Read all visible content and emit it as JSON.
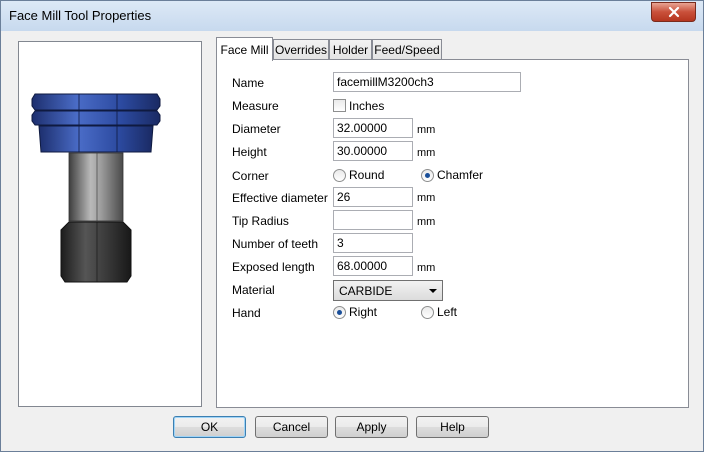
{
  "window": {
    "title": "Face Mill Tool Properties",
    "close_icon": "close-icon"
  },
  "tabs": [
    "Face Mill",
    "Overrides",
    "Holder",
    "Feed/Speed"
  ],
  "active_tab": "Face Mill",
  "form": {
    "name": {
      "label": "Name",
      "value": "facemillM3200ch3"
    },
    "measure": {
      "label": "Measure",
      "checkbox_label": "Inches",
      "checked": false
    },
    "diameter": {
      "label": "Diameter",
      "value": "32.00000",
      "unit": "mm"
    },
    "height": {
      "label": "Height",
      "value": "30.00000",
      "unit": "mm"
    },
    "corner": {
      "label": "Corner",
      "option_a": "Round",
      "option_b": "Chamfer",
      "selected": "Chamfer"
    },
    "effective_diameter": {
      "label": "Effective diameter",
      "value": "26",
      "unit": "mm"
    },
    "tip_radius": {
      "label": "Tip Radius",
      "value": "",
      "unit": "mm"
    },
    "number_of_teeth": {
      "label": "Number of teeth",
      "value": "3"
    },
    "exposed_length": {
      "label": "Exposed length",
      "value": "68.00000",
      "unit": "mm"
    },
    "material": {
      "label": "Material",
      "value": "CARBIDE"
    },
    "hand": {
      "label": "Hand",
      "option_a": "Right",
      "option_b": "Left",
      "selected": "Right"
    }
  },
  "buttons": {
    "ok": "OK",
    "cancel": "Cancel",
    "apply": "Apply",
    "help": "Help"
  },
  "colors": {
    "tool_blue": "#2f4ea3",
    "shank_grey": "#8c8c8c",
    "holder_dark": "#3a3a3a",
    "title_bar": "#c7d9ee"
  }
}
